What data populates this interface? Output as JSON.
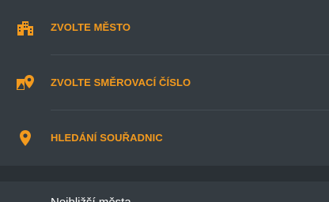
{
  "menu": {
    "items": [
      {
        "label": "ZVOLTE MĚSTO",
        "icon": "city-icon"
      },
      {
        "label": "ZVOLTE SMĚROVACÍ ČÍSLO",
        "icon": "map-marker-icon"
      },
      {
        "label": "HLEDÁNÍ SOUŘADNIC",
        "icon": "location-pin-icon"
      }
    ]
  },
  "section": {
    "title": "Nejbližší města"
  },
  "colors": {
    "accent": "#f39a1e",
    "background": "#343b41",
    "separator": "#2a3035",
    "text": "#ffffff"
  }
}
